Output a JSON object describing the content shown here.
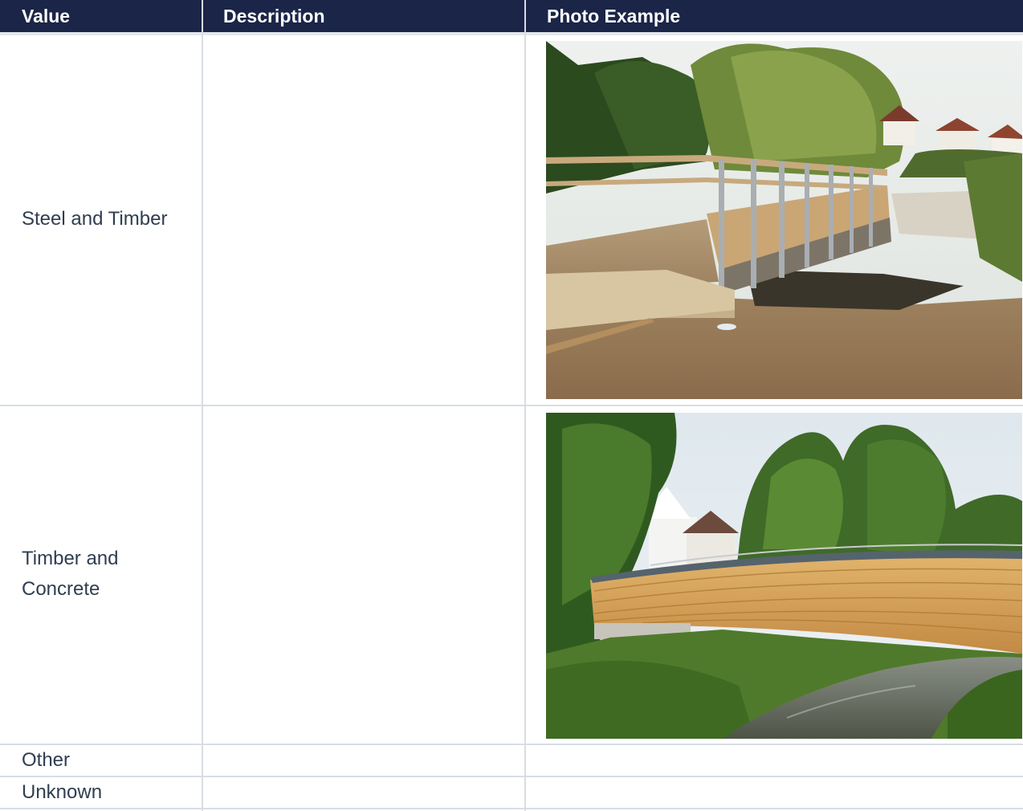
{
  "table": {
    "headers": [
      "Value",
      "Description",
      "Photo Example"
    ],
    "rows": [
      {
        "value": "Steel and Timber",
        "description": "",
        "photo": "steel-and-timber-footbridge-photo"
      },
      {
        "value": "Timber and Concrete",
        "description": "",
        "photo": "timber-and-concrete-footbridge-photo"
      },
      {
        "value": "Other",
        "description": "",
        "photo": ""
      },
      {
        "value": "Unknown",
        "description": "",
        "photo": ""
      }
    ]
  },
  "colors": {
    "header_bg": "#1b2547",
    "header_text": "#ffffff",
    "body_text": "#2f3e50",
    "grid_line": "#d8dde3"
  }
}
